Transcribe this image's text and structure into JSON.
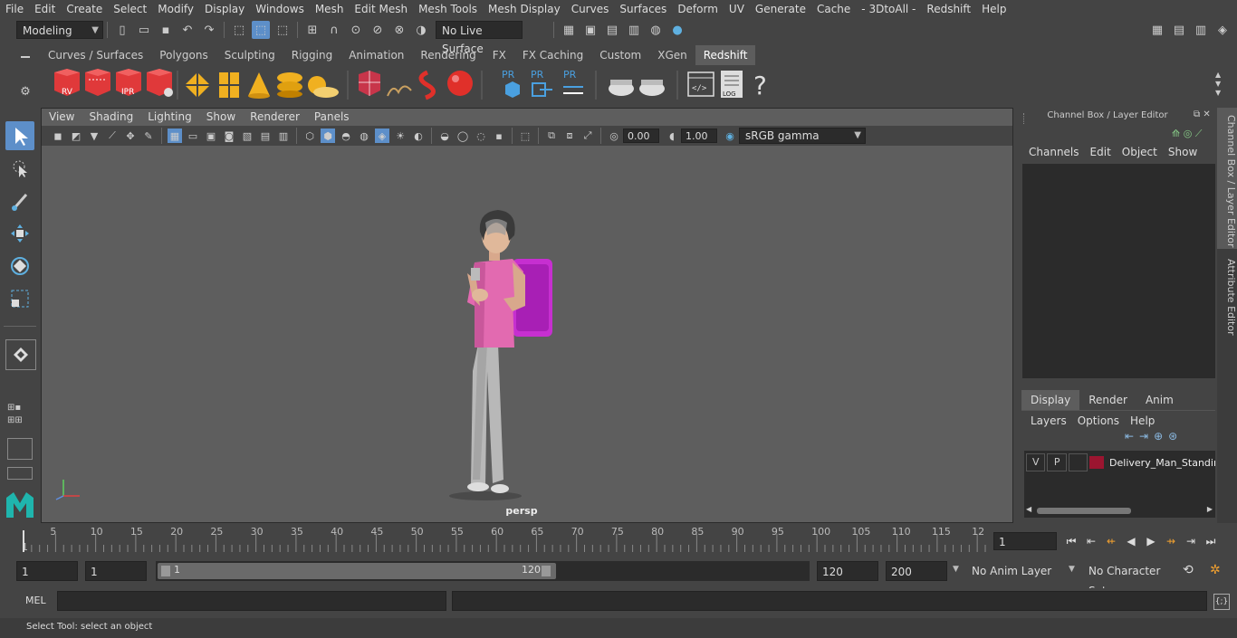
{
  "menu": [
    "File",
    "Edit",
    "Create",
    "Select",
    "Modify",
    "Display",
    "Windows",
    "Mesh",
    "Edit Mesh",
    "Mesh Tools",
    "Mesh Display",
    "Curves",
    "Surfaces",
    "Deform",
    "UV",
    "Generate",
    "Cache",
    "- 3DtoAll -",
    "Redshift",
    "Help"
  ],
  "status": {
    "mode": "Modeling",
    "live_surface": "No Live Surface"
  },
  "shelf_tabs": [
    "Curves / Surfaces",
    "Polygons",
    "Sculpting",
    "Rigging",
    "Animation",
    "Rendering",
    "FX",
    "FX Caching",
    "Custom",
    "XGen",
    "Redshift"
  ],
  "shelf_active": "Redshift",
  "shelf_labels": {
    "rv": "RV",
    "ipr": "IPR",
    "pr1": "PR",
    "pr2": "PR",
    "pr3": "PR",
    "log": "LOG",
    "help": "?"
  },
  "viewport": {
    "menu": [
      "View",
      "Shading",
      "Lighting",
      "Show",
      "Renderer",
      "Panels"
    ],
    "exposure": "0.00",
    "gamma": "1.00",
    "color_space": "sRGB gamma",
    "camera": "persp"
  },
  "channel_box": {
    "title": "Channel Box / Layer Editor",
    "menu": [
      "Channels",
      "Edit",
      "Object",
      "Show"
    ],
    "layer_tabs": [
      "Display",
      "Render",
      "Anim"
    ],
    "layer_menu": [
      "Layers",
      "Options",
      "Help"
    ],
    "layer": {
      "v": "V",
      "p": "P",
      "name": "Delivery_Man_Standin",
      "color": "#9b1530"
    }
  },
  "side_tabs": [
    "Channel Box / Layer Editor",
    "Attribute Editor"
  ],
  "timeline": {
    "ticks": [
      "1",
      "5",
      "10",
      "15",
      "20",
      "25",
      "30",
      "35",
      "40",
      "45",
      "50",
      "55",
      "60",
      "65",
      "70",
      "75",
      "80",
      "85",
      "90",
      "95",
      "100",
      "105",
      "110",
      "115",
      "12"
    ],
    "current": "1"
  },
  "range": {
    "start": "1",
    "playback_start": "1",
    "slider_start": "1",
    "slider_end": "120",
    "playback_end": "120",
    "end": "200",
    "anim_layer": "No Anim Layer",
    "char_set": "No Character Set"
  },
  "cmd": {
    "label": "MEL"
  },
  "help_line": "Select Tool: select an object",
  "colors": {
    "accent": "#5d8fc9",
    "shelf_red": "#e0393a",
    "shelf_yellow": "#f0b020"
  }
}
